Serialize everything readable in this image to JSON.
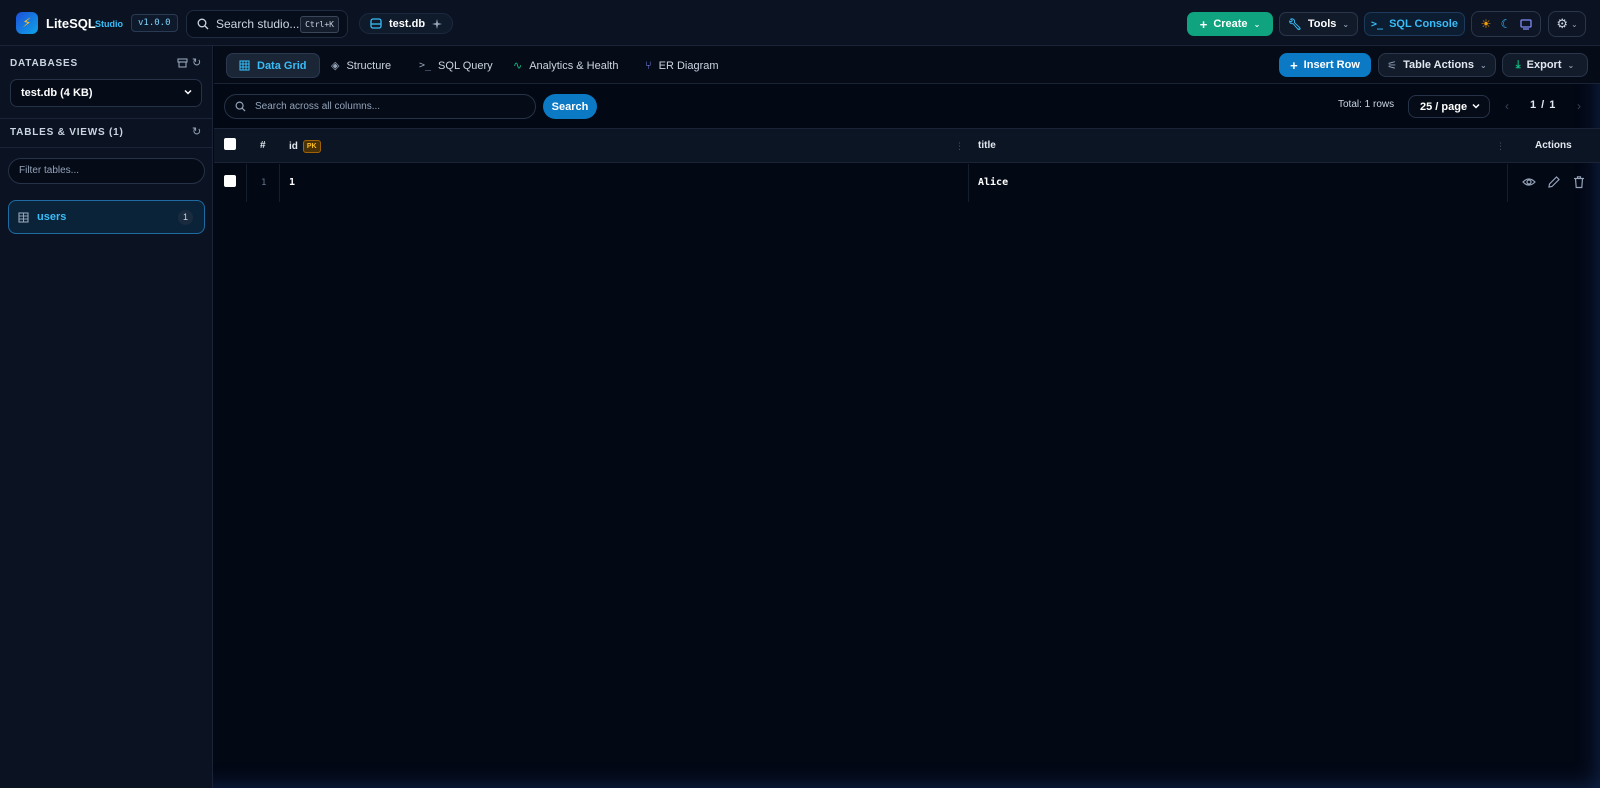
{
  "header": {
    "brand": "LiteSQL",
    "brand_sub": "Studio",
    "version": "v1.0.0",
    "search_placeholder": "Search studio...",
    "shortcut": "Ctrl+K",
    "db_chip": "test.db",
    "create_label": "Create",
    "tools_label": "Tools",
    "console_label": "SQL Console"
  },
  "sidebar": {
    "databases_title": "DATABASES",
    "selected_db": "test.db (4 KB)",
    "tables_title": "TABLES & VIEWS (1)",
    "filter_placeholder": "Filter tables...",
    "tables": [
      {
        "label": "users",
        "count": "1"
      }
    ]
  },
  "tabs": [
    {
      "label": "Data Grid",
      "active": true
    },
    {
      "label": "Structure"
    },
    {
      "label": "SQL Query"
    },
    {
      "label": "Analytics & Health"
    },
    {
      "label": "ER Diagram"
    }
  ],
  "toolbar": {
    "insert_label": "Insert Row",
    "table_actions_label": "Table Actions",
    "export_label": "Export",
    "search_placeholder": "Search across all columns...",
    "search_button": "Search",
    "total": "Total: 1 rows",
    "per_page": "25 / page",
    "page": "1 / 1"
  },
  "grid": {
    "columns": {
      "num": "#",
      "id": "id",
      "pk": "PK",
      "title": "title",
      "actions": "Actions"
    },
    "rows": [
      {
        "num": "1",
        "id": "1",
        "title": "Alice"
      }
    ]
  },
  "colors": {
    "accent": "#38bdf8",
    "create": "#10a37f",
    "primary": "#0b79c4",
    "background": "#030815"
  }
}
